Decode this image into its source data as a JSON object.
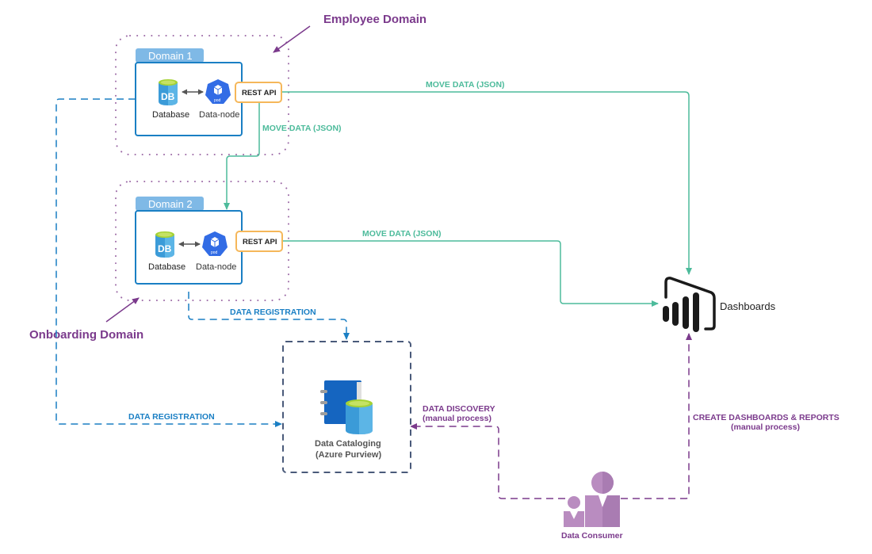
{
  "annotations": {
    "employee_domain": "Employee Domain",
    "onboarding_domain": "Onboarding Domain"
  },
  "domains": [
    {
      "tab_label": "Domain 1",
      "database_label": "Database",
      "database_icon_text": "DB",
      "datanode_label": "Data-node",
      "datanode_icon_text": "pod",
      "api_label": "REST API"
    },
    {
      "tab_label": "Domain 2",
      "database_label": "Database",
      "database_icon_text": "DB",
      "datanode_label": "Data-node",
      "datanode_icon_text": "pod",
      "api_label": "REST API"
    }
  ],
  "flows": {
    "move_data_d1_to_dash": "MOVE DATA (JSON)",
    "move_data_d1_to_d2": "MOVE DATA (JSON)",
    "move_data_d2_to_dash": "MOVE DATA (JSON)",
    "data_registration_d2": "DATA REGISTRATION",
    "data_registration_d1": "DATA REGISTRATION",
    "data_discovery_line1": "DATA DISCOVERY",
    "data_discovery_line2": "(manual process)",
    "create_dashboards_line1": "CREATE DASHBOARDS & REPORTS",
    "create_dashboards_line2": "(manual process)"
  },
  "catalog": {
    "line1": "Data Cataloging",
    "line2": "(Azure Purview)"
  },
  "dashboards": {
    "label": "Dashboards"
  },
  "consumer": {
    "label": "Data Consumer"
  },
  "colors": {
    "teal": "#4dbb9b",
    "blue": "#1a7fc4",
    "purple": "#7b3a8c",
    "orange": "#f5b75a",
    "domain_border": "#1a7fc4",
    "tab_fill": "#7fb9e6"
  }
}
